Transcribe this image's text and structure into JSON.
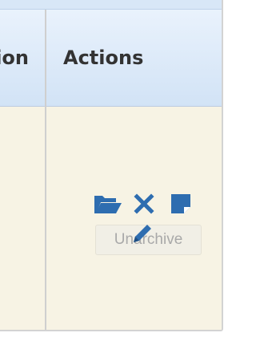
{
  "table": {
    "header": {
      "previous_column_fragment": "ion",
      "actions_label": "Actions"
    },
    "row": {
      "actions": [
        {
          "name": "folder-open-icon",
          "label": "Unarchive"
        },
        {
          "name": "close-icon"
        },
        {
          "name": "note-icon"
        },
        {
          "name": "pencil-icon"
        }
      ]
    }
  },
  "tooltip": {
    "text": "Unarchive"
  },
  "colors": {
    "header_bg": "#dbe8f7",
    "row_bg": "#f7f3e4",
    "icon": "#2e6db0",
    "tooltip_text": "#a9a9a9"
  }
}
